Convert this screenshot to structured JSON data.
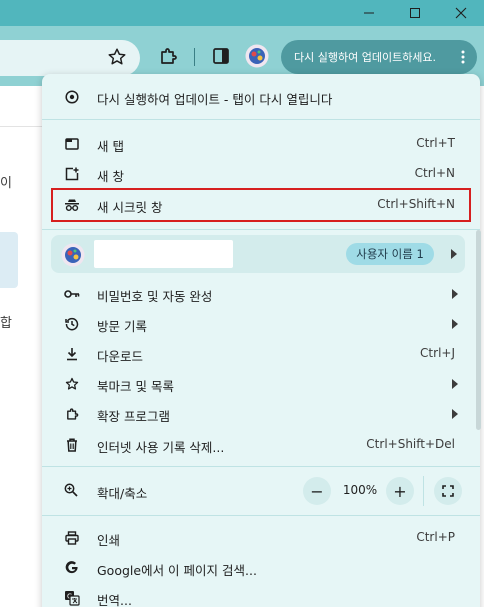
{
  "window": {
    "minimize_icon": "minimize-icon",
    "maximize_icon": "maximize-icon",
    "close_icon": "close-icon"
  },
  "toolbar": {
    "update_button_label": "다시 실행하여 업데이트하세요.",
    "icons": [
      "star-icon",
      "extensions-icon",
      "side-panel-icon",
      "profile-icon",
      "kebab-menu-icon"
    ]
  },
  "page_fragments": {
    "frag_1": "이",
    "frag_2": "합"
  },
  "menu": {
    "relaunch": {
      "label": "다시 실행하여 업데이트 - 탭이 다시 열립니다",
      "icon": "relaunch-icon"
    },
    "new_tab": {
      "label": "새 탭",
      "shortcut": "Ctrl+T",
      "icon": "new-tab-icon"
    },
    "new_window": {
      "label": "새 창",
      "shortcut": "Ctrl+N",
      "icon": "new-window-icon"
    },
    "incognito": {
      "label": "새 시크릿 창",
      "shortcut": "Ctrl+Shift+N",
      "icon": "incognito-icon"
    },
    "profile": {
      "chip_label": "사용자 이름 1",
      "icon": "profile-avatar"
    },
    "passwords": {
      "label": "비밀번호 및 자동 완성",
      "icon": "key-icon"
    },
    "history": {
      "label": "방문 기록",
      "icon": "history-icon"
    },
    "downloads": {
      "label": "다운로드",
      "shortcut": "Ctrl+J",
      "icon": "download-icon"
    },
    "bookmarks": {
      "label": "북마크 및 목록",
      "icon": "star-icon"
    },
    "extensions": {
      "label": "확장 프로그램",
      "icon": "extensions-icon"
    },
    "clear_data": {
      "label": "인터넷 사용 기록 삭제...",
      "shortcut": "Ctrl+Shift+Del",
      "icon": "trash-icon"
    },
    "zoom": {
      "label": "확대/축소",
      "value": "100%",
      "minus": "−",
      "plus": "+",
      "icon": "zoom-icon"
    },
    "print": {
      "label": "인쇄",
      "shortcut": "Ctrl+P",
      "icon": "print-icon"
    },
    "google_search": {
      "label": "Google에서 이 페이지 검색...",
      "icon": "google-icon"
    },
    "translate": {
      "label": "번역...",
      "icon": "translate-icon"
    }
  },
  "colors": {
    "titlebar": "#51b6bd",
    "toolbar": "#8fd1d3",
    "menu_bg": "#e6f6f6",
    "highlight": "#d61f1f",
    "chip": "#9fdbe6"
  }
}
